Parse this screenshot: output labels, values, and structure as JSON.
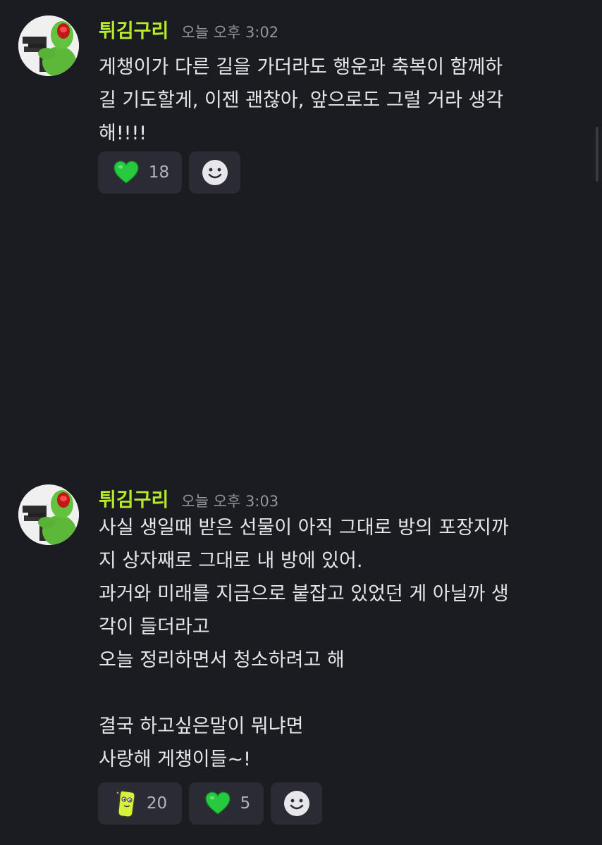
{
  "messages": [
    {
      "username": "튀김구리",
      "timestamp": "오늘 오후 3:02",
      "avatar_icon": "kermit-frog-avatar",
      "lines": [
        "게챙이가 다른 길을 가더라도 행운과 축복이 함께하",
        "길 기도할게, 이젠 괜찮아, 앞으로도 그럴 거라 생각",
        "해!!!!"
      ],
      "reactions": [
        {
          "icon": "green-heart-icon",
          "count": "18"
        }
      ],
      "add_reaction_icon": "smiley-face-icon"
    },
    {
      "username": "튀김구리",
      "timestamp": "오늘 오후 3:03",
      "avatar_icon": "kermit-frog-avatar",
      "lines": [
        "사실 생일때 받은 선물이 아직 그대로 방의 포장지까",
        "지 상자째로 그대로 내 방에 있어.",
        "과거와 미래를 지금으로 붙잡고 있었던 게 아닐까 생",
        "각이 들더라고",
        "오늘 정리하면서 청소하려고 해",
        "",
        "결국 하고싶은말이 뭐냐면",
        "사랑해 게챙이들~!"
      ],
      "reactions": [
        {
          "icon": "yellow-green-character-sticker-icon",
          "count": "20"
        },
        {
          "icon": "green-heart-icon",
          "count": "5"
        }
      ],
      "add_reaction_icon": "smiley-face-icon"
    }
  ],
  "colors": {
    "background": "#1b1c22",
    "username": "#b7ea2b",
    "timestamp": "#92949c",
    "text": "#e6e6ea",
    "chip": "#2a2b33"
  }
}
